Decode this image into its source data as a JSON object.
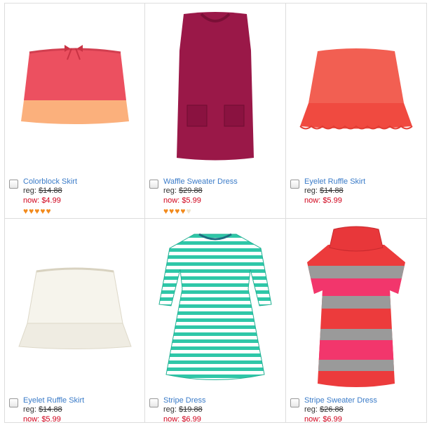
{
  "products": [
    {
      "name": "Colorblock Skirt",
      "reg_label": "reg:",
      "reg_price": "$14.88",
      "now_label": "now:",
      "now_price": "$4.99",
      "rating": 5,
      "image": "colorblock-skirt",
      "colors": {
        "top": "#ec5060",
        "bottom": "#fbb07c"
      }
    },
    {
      "name": "Waffle Sweater Dress",
      "reg_label": "reg:",
      "reg_price": "$29.88",
      "now_label": "now:",
      "now_price": "$5.99",
      "rating": 4,
      "image": "waffle-sweater-dress",
      "colors": {
        "main": "#9a1848"
      }
    },
    {
      "name": "Eyelet Ruffle Skirt",
      "reg_label": "reg:",
      "reg_price": "$14.88",
      "now_label": "now:",
      "now_price": "$5.99",
      "rating": null,
      "image": "eyelet-ruffle-skirt-coral",
      "colors": {
        "main": "#f25f52"
      }
    },
    {
      "name": "Eyelet Ruffle Skirt",
      "reg_label": "reg:",
      "reg_price": "$14.88",
      "now_label": "now:",
      "now_price": "$5.99",
      "rating": null,
      "image": "eyelet-ruffle-skirt-white",
      "colors": {
        "main": "#f6f4ec"
      }
    },
    {
      "name": "Stripe Dress",
      "reg_label": "reg:",
      "reg_price": "$19.88",
      "now_label": "now:",
      "now_price": "$6.99",
      "rating": null,
      "image": "stripe-dress",
      "colors": {
        "stripe": "#2fc7a8",
        "base": "#ffffff"
      }
    },
    {
      "name": "Stripe Sweater Dress",
      "reg_label": "reg:",
      "reg_price": "$26.88",
      "now_label": "now:",
      "now_price": "$6.99",
      "rating": null,
      "image": "stripe-sweater-dress",
      "colors": {
        "red": "#ec3b3c",
        "pink": "#f2366c",
        "gray": "#9a9a9a"
      }
    }
  ],
  "rating_max": 5,
  "accent_colors": {
    "link": "#3a7bc8",
    "sale": "#d0021b",
    "heart_on": "#f28a1c",
    "heart_off": "#efe4cc"
  }
}
